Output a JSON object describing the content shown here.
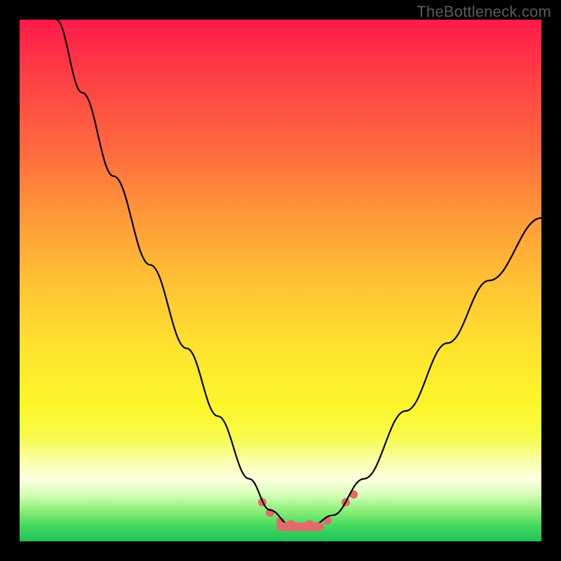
{
  "watermark": "TheBottleneck.com",
  "chart_data": {
    "type": "line",
    "title": "",
    "xlabel": "",
    "ylabel": "",
    "xlim": [
      0,
      1
    ],
    "ylim": [
      0,
      1
    ],
    "series": [
      {
        "name": "curve",
        "x": [
          0.07,
          0.12,
          0.18,
          0.25,
          0.32,
          0.38,
          0.44,
          0.48,
          0.52,
          0.56,
          0.6,
          0.66,
          0.74,
          0.82,
          0.9,
          1.0
        ],
        "y": [
          1.0,
          0.86,
          0.7,
          0.53,
          0.37,
          0.24,
          0.12,
          0.06,
          0.03,
          0.03,
          0.05,
          0.12,
          0.25,
          0.38,
          0.5,
          0.62
        ]
      }
    ],
    "markers": [
      {
        "x": 0.465,
        "y": 0.075,
        "r": 6
      },
      {
        "x": 0.48,
        "y": 0.055,
        "r": 6
      },
      {
        "x": 0.5,
        "y": 0.038,
        "r": 6
      },
      {
        "x": 0.52,
        "y": 0.03,
        "r": 8
      },
      {
        "x": 0.555,
        "y": 0.03,
        "r": 8
      },
      {
        "x": 0.59,
        "y": 0.04,
        "r": 6
      },
      {
        "x": 0.625,
        "y": 0.075,
        "r": 6
      },
      {
        "x": 0.64,
        "y": 0.09,
        "r": 6
      }
    ],
    "colors": {
      "curve": "#000000",
      "marker": "#e46a6a"
    }
  }
}
